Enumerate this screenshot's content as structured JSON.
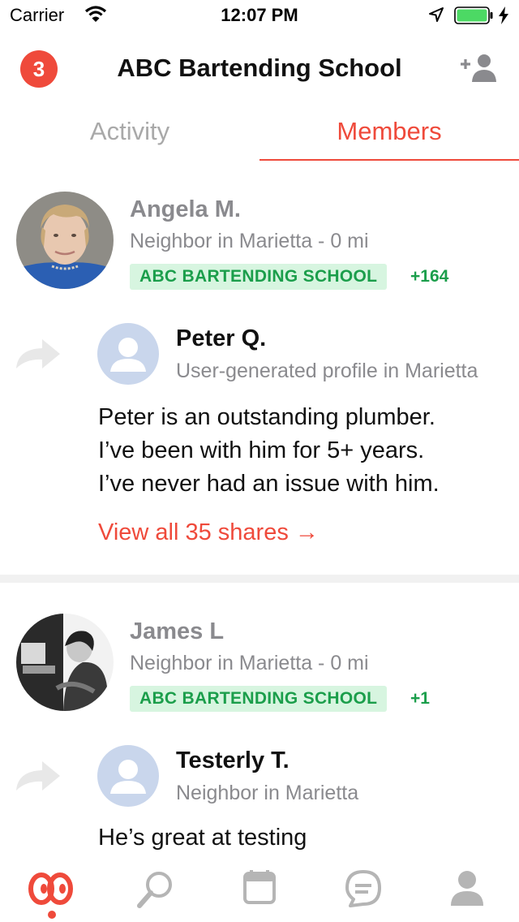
{
  "status_bar": {
    "carrier": "Carrier",
    "time": "12:07 PM"
  },
  "header": {
    "badge_count": "3",
    "title": "ABC Bartending School"
  },
  "tabs": [
    {
      "label": "Activity",
      "active": false
    },
    {
      "label": "Members",
      "active": true
    }
  ],
  "members": [
    {
      "name": "Angela M.",
      "subtitle": "Neighbor in Marietta - 0 mi",
      "tag": "ABC BARTENDING SCHOOL",
      "plus": "+164",
      "share": {
        "profile_name": "Peter Q.",
        "profile_subtitle": "User-generated profile in Marietta",
        "body_lines": [
          "Peter is an outstanding plumber.",
          "I’ve been with him for 5+ years.",
          "I’ve never had an issue with him."
        ],
        "view_all": "View all 35 shares →"
      }
    },
    {
      "name": "James L",
      "subtitle": "Neighbor in Marietta - 0 mi",
      "tag": "ABC BARTENDING SCHOOL",
      "plus": "+1",
      "share": {
        "profile_name": "Testerly T.",
        "profile_subtitle": "Neighbor in Marietta",
        "body_lines": [
          "He’s great at testing"
        ]
      }
    }
  ],
  "tab_bar": {
    "items": [
      "home-icon",
      "search-icon",
      "calendar-icon",
      "messages-icon",
      "profile-icon"
    ],
    "active_index": 0
  },
  "colors": {
    "accent": "#ef4a3b",
    "tag_bg": "#d7f5e0",
    "tag_text": "#1b9e4b",
    "battery": "#4cd964"
  }
}
